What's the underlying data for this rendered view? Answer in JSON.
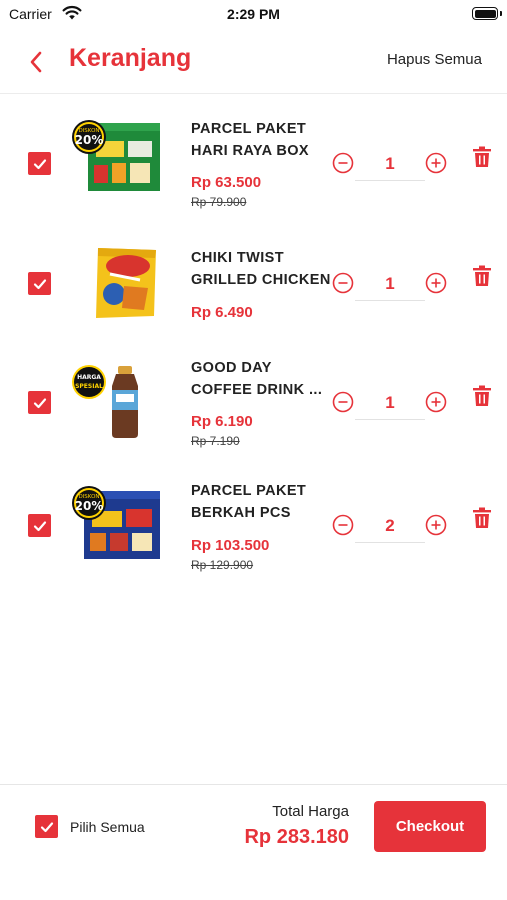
{
  "status_bar": {
    "carrier": "Carrier",
    "time": "2:29 PM"
  },
  "header": {
    "title": "Keranjang",
    "clear_all": "Hapus Semua"
  },
  "badges": {
    "discount_top": "DISKON",
    "discount_value": "20%",
    "special_top": "HARGA",
    "special_bottom": "SPESIAL"
  },
  "items": [
    {
      "name_line1": "PARCEL PAKET",
      "name_line2": "HARI RAYA  BOX",
      "price": "Rp 63.500",
      "old_price": "Rp 79.900",
      "qty": "1",
      "checked": true,
      "badge": "discount"
    },
    {
      "name_line1": "CHIKI TWIST",
      "name_line2": "GRILLED CHICKEN",
      "price": "Rp 6.490",
      "old_price": "",
      "qty": "1",
      "checked": true,
      "badge": "none"
    },
    {
      "name_line1": "GOOD DAY",
      "name_line2": "COFFEE DRINK ...",
      "price": "Rp 6.190",
      "old_price": "Rp 7.190",
      "qty": "1",
      "checked": true,
      "badge": "special"
    },
    {
      "name_line1": "PARCEL PAKET",
      "name_line2": "BERKAH  PCS",
      "price": "Rp 103.500",
      "old_price": "Rp 129.900",
      "qty": "2",
      "checked": true,
      "badge": "discount"
    }
  ],
  "footer": {
    "select_all_label": "Pilih Semua",
    "total_label": "Total Harga",
    "total_value": "Rp 283.180",
    "checkout_label": "Checkout"
  },
  "colors": {
    "accent": "#e6333a"
  },
  "icons": [
    "wifi-icon",
    "battery-icon",
    "back-chevron-icon",
    "checkmark-icon",
    "minus-circle-icon",
    "plus-circle-icon",
    "trash-icon"
  ]
}
